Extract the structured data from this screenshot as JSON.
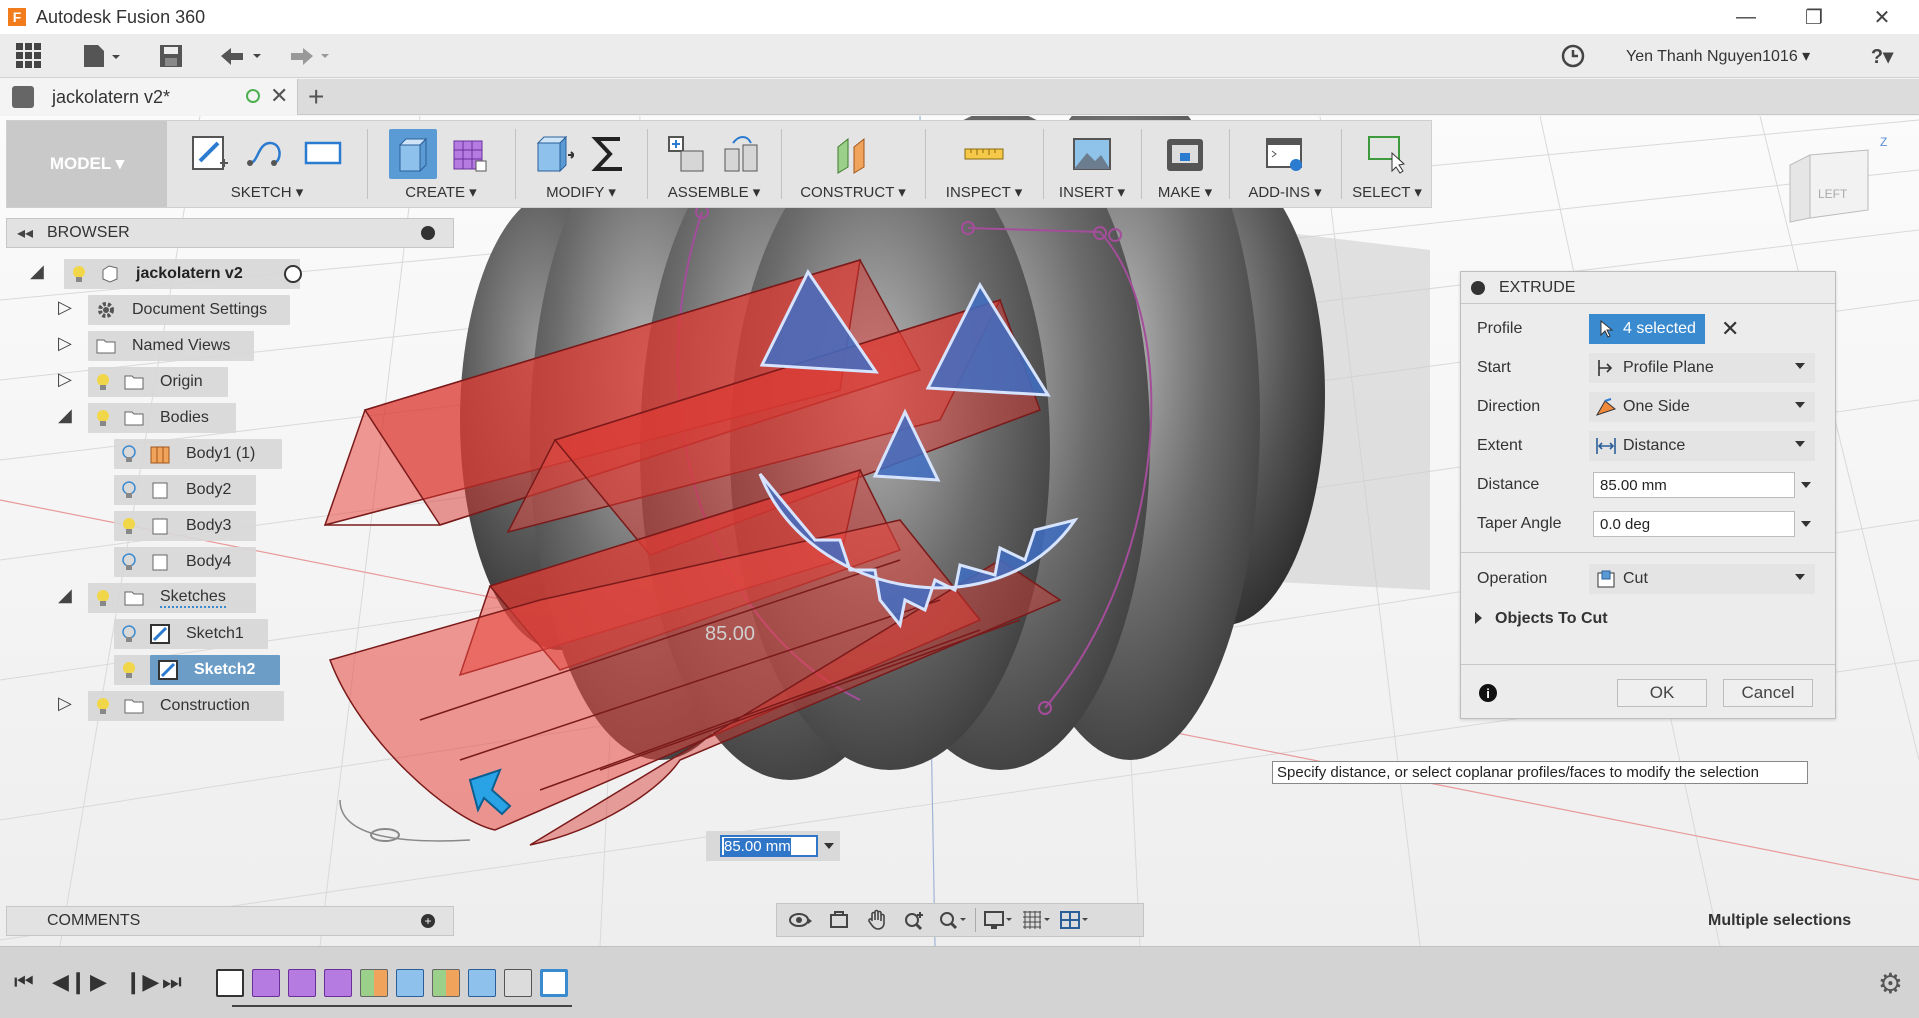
{
  "window": {
    "title": "Autodesk Fusion 360",
    "logo_letter": "F",
    "minimize": "—",
    "restore": "❐",
    "close": "✕"
  },
  "app_toolbar": {
    "user_name": "Yen Thanh Nguyen1016 ▾",
    "help": "?▾"
  },
  "document_tab": {
    "name": "jackolatern v2*",
    "close": "✕",
    "new_tab": "+"
  },
  "ribbon": {
    "workspace": "MODEL ▾",
    "groups": [
      "SKETCH ▾",
      "CREATE ▾",
      "MODIFY ▾",
      "ASSEMBLE ▾",
      "CONSTRUCT ▾",
      "INSPECT ▾",
      "INSERT ▾",
      "MAKE ▾",
      "ADD-INS ▾",
      "SELECT ▾"
    ]
  },
  "browser": {
    "title": "BROWSER",
    "collapse": "◂◂",
    "items": [
      {
        "label": "jackolatern v2"
      },
      {
        "label": "Document Settings"
      },
      {
        "label": "Named Views"
      },
      {
        "label": "Origin"
      },
      {
        "label": "Bodies"
      },
      {
        "label": "Body1 (1)"
      },
      {
        "label": "Body2"
      },
      {
        "label": "Body3"
      },
      {
        "label": "Body4"
      },
      {
        "label": "Sketches"
      },
      {
        "label": "Sketch1"
      },
      {
        "label": "Sketch2"
      },
      {
        "label": "Construction"
      }
    ]
  },
  "extrude": {
    "title": "EXTRUDE",
    "profile_label": "Profile",
    "profile_value": "4 selected",
    "start_label": "Start",
    "start_value": "Profile Plane",
    "direction_label": "Direction",
    "direction_value": "One Side",
    "extent_label": "Extent",
    "extent_value": "Distance",
    "distance_label": "Distance",
    "distance_value": "85.00 mm",
    "taper_label": "Taper Angle",
    "taper_value": "0.0 deg",
    "operation_label": "Operation",
    "operation_value": "Cut",
    "objects_to_cut": "Objects To Cut",
    "ok": "OK",
    "cancel": "Cancel",
    "info": "i"
  },
  "tooltip": "Specify distance, or select coplanar profiles/faces to modify the selection",
  "viewport": {
    "dimension_label": "85.00",
    "hud_value": "85.00 mm",
    "status": "Multiple selections",
    "viewcube_face": "LEFT"
  },
  "comments": {
    "title": "COMMENTS",
    "add": "+"
  },
  "colors": {
    "accent": "#3a8ad0",
    "selection_blue": "#3f6fc4",
    "extrude_red": "#e8473f",
    "pumpkin_gray": "#5a5a5a"
  }
}
